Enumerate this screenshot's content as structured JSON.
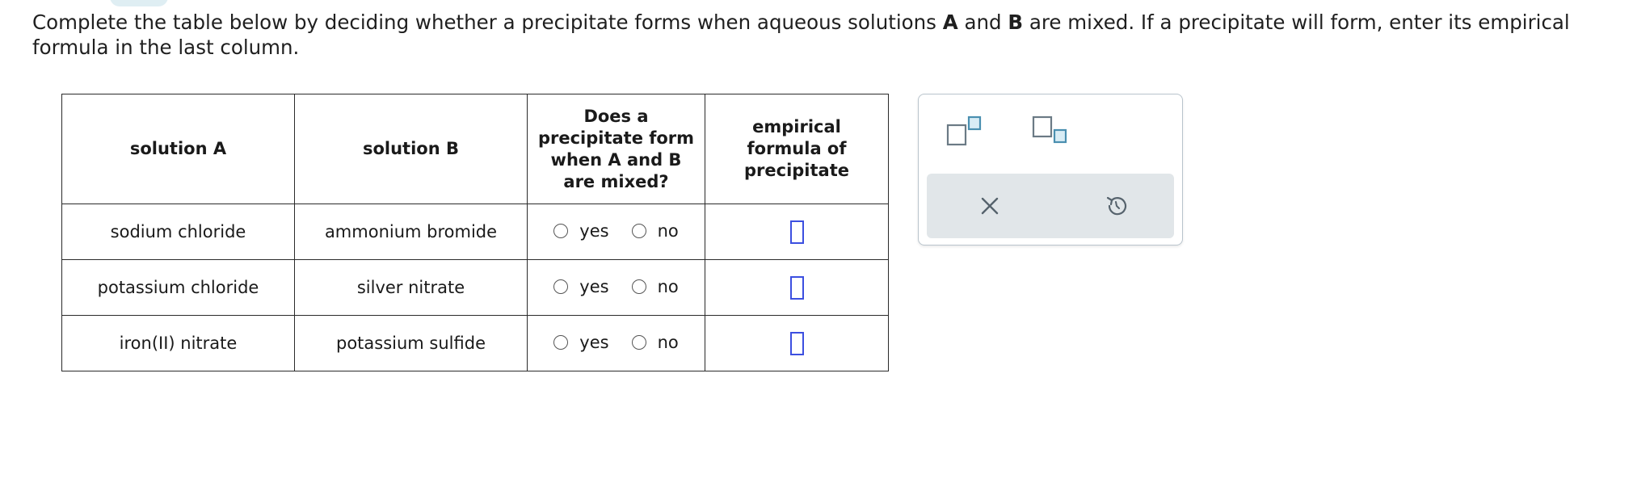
{
  "instructions": {
    "part1": "Complete the table below by deciding whether a precipitate forms when aqueous solutions ",
    "bold_a": "A",
    "part2": " and ",
    "bold_b": "B",
    "part3": " are mixed. If a precipitate will form, enter its empirical formula in the last column."
  },
  "table": {
    "headers": {
      "solution_a": "solution A",
      "solution_b": "solution B",
      "precipitate_question": "Does a precipitate form when A and B are mixed?",
      "empirical_formula": "empirical formula of precipitate"
    },
    "rows": [
      {
        "solution_a": "sodium chloride",
        "solution_b": "ammonium bromide",
        "yes_label": "yes",
        "no_label": "no",
        "formula_value": ""
      },
      {
        "solution_a": "potassium chloride",
        "solution_b": "silver nitrate",
        "yes_label": "yes",
        "no_label": "no",
        "formula_value": ""
      },
      {
        "solution_a": "iron(II) nitrate",
        "solution_b": "potassium sulfide",
        "yes_label": "yes",
        "no_label": "no",
        "formula_value": ""
      }
    ]
  },
  "tools": {
    "superscript_icon": "superscript-icon",
    "subscript_icon": "subscript-icon",
    "clear_icon": "close-icon",
    "undo_icon": "undo-icon"
  },
  "colors": {
    "answer_box_border": "#3c4fe0",
    "tool_icon_teal": "#4a8fb0",
    "tool_action_bg": "#e1e6e9"
  }
}
